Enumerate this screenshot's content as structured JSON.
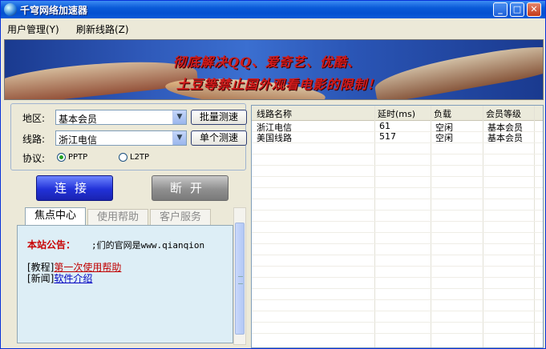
{
  "window": {
    "title": "千穹网络加速器",
    "controls": {
      "minimize": "_",
      "maximize": "□",
      "close": "✕"
    }
  },
  "menu": {
    "items": [
      "用户管理(Y)",
      "刷新线路(Z)"
    ]
  },
  "banner": {
    "line1": "彻底解决QQ、爱奇艺、优酷、",
    "line2": "土豆等禁止国外观看电影的限制！"
  },
  "settings": {
    "region_label": "地区:",
    "region_value": "基本会员",
    "line_label": "线路:",
    "line_value": "浙江电信",
    "protocol_label": "协议:",
    "protocol_options": [
      "PPTP",
      "L2TP"
    ],
    "protocol_selected": "PPTP",
    "batch_test_label": "批量测速",
    "single_test_label": "单个测速"
  },
  "actions": {
    "connect_label": "连接",
    "disconnect_label": "断开"
  },
  "tabs": [
    {
      "label": "焦点中心",
      "active": true
    },
    {
      "label": "使用帮助",
      "active": false
    },
    {
      "label": "客户服务",
      "active": false
    }
  ],
  "announcement": {
    "label": "本站公告：",
    "text": ";们的官网是www.qianqion",
    "items": [
      {
        "prefix": "[教程]",
        "link": "第一次使用帮助"
      },
      {
        "prefix": "[新闻]",
        "link": "软件介绍"
      }
    ]
  },
  "lines_table": {
    "columns": [
      "线路名称",
      "延时(ms)",
      "负载",
      "会员等级"
    ],
    "rows": [
      [
        "浙江电信",
        "61",
        "空闲",
        "基本会员"
      ],
      [
        "美国线路",
        "517",
        "空闲",
        "基本会员"
      ]
    ]
  }
}
